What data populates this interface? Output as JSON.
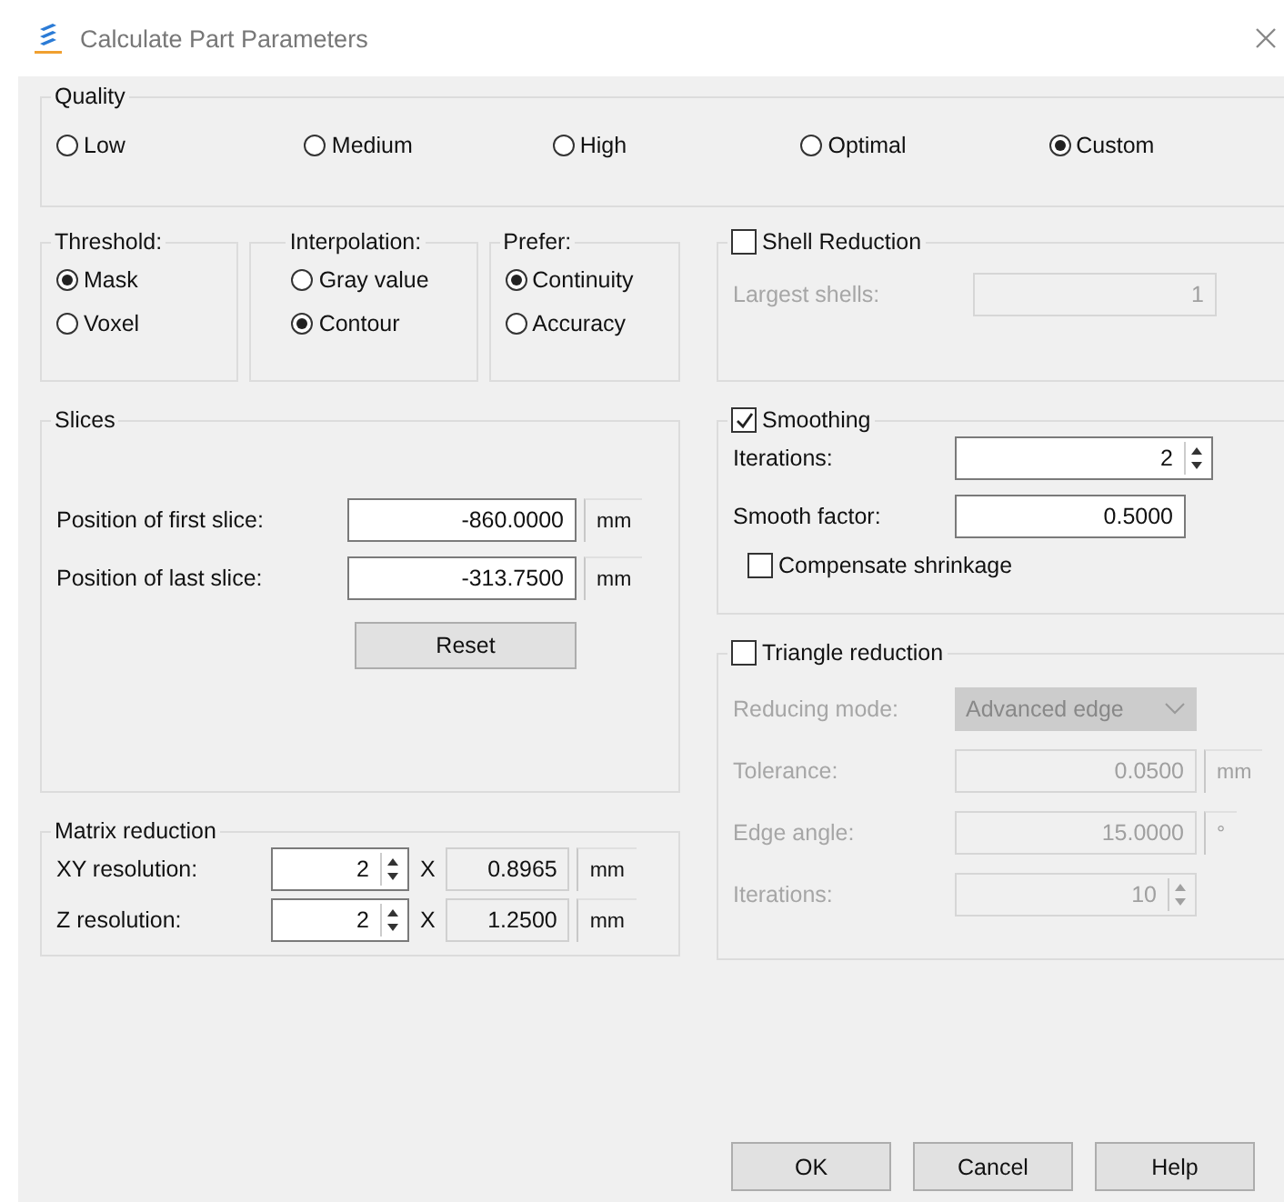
{
  "window": {
    "title": "Calculate Part Parameters"
  },
  "quality": {
    "title": "Quality",
    "options": [
      {
        "label": "Low",
        "selected": false
      },
      {
        "label": "Medium",
        "selected": false
      },
      {
        "label": "High",
        "selected": false
      },
      {
        "label": "Optimal",
        "selected": false
      },
      {
        "label": "Custom",
        "selected": true
      }
    ]
  },
  "threshold": {
    "title": "Threshold:",
    "options": [
      {
        "label": "Mask",
        "selected": true
      },
      {
        "label": "Voxel",
        "selected": false
      }
    ]
  },
  "interpolation": {
    "title": "Interpolation:",
    "options": [
      {
        "label": "Gray value",
        "selected": false
      },
      {
        "label": "Contour",
        "selected": true
      }
    ]
  },
  "prefer": {
    "title": "Prefer:",
    "options": [
      {
        "label": "Continuity",
        "selected": true
      },
      {
        "label": "Accuracy",
        "selected": false
      }
    ]
  },
  "shell_reduction": {
    "label": "Shell Reduction",
    "checked": false,
    "fields": [
      {
        "label": "Largest shells:",
        "value": "1",
        "disabled": true
      }
    ]
  },
  "slices": {
    "title": "Slices",
    "fields": [
      {
        "label": "Position of first slice:",
        "value": "-860.0000",
        "unit": "mm"
      },
      {
        "label": "Position of last slice:",
        "value": "-313.7500",
        "unit": "mm"
      }
    ],
    "reset_button": "Reset"
  },
  "matrix_reduction": {
    "title": "Matrix reduction",
    "rows": [
      {
        "label": "XY resolution:",
        "value": "2",
        "times": "X",
        "result": "0.8965",
        "unit": "mm"
      },
      {
        "label": "Z resolution:",
        "value": "2",
        "times": "X",
        "result": "1.2500",
        "unit": "mm"
      }
    ]
  },
  "smoothing": {
    "label": "Smoothing",
    "checked": true,
    "fields": [
      {
        "kind": "spin",
        "label": "Iterations:",
        "value": "2",
        "disabled": false
      },
      {
        "kind": "text",
        "label": "Smooth factor:",
        "value": "0.5000",
        "disabled": false
      }
    ],
    "compensate": {
      "label": "Compensate shrinkage",
      "checked": false
    }
  },
  "triangle_reduction": {
    "label": "Triangle reduction",
    "checked": false,
    "fields": [
      {
        "kind": "select",
        "label": "Reducing mode:",
        "value": "Advanced edge",
        "disabled": true
      },
      {
        "kind": "text",
        "label": "Tolerance:",
        "value": "0.0500",
        "unit": "mm",
        "disabled": true
      },
      {
        "kind": "text",
        "label": "Edge angle:",
        "value": "15.0000",
        "unit": "°",
        "disabled": true
      },
      {
        "kind": "spin",
        "label": "Iterations:",
        "value": "10",
        "disabled": true
      }
    ]
  },
  "buttons": [
    "OK",
    "Cancel",
    "Help"
  ]
}
